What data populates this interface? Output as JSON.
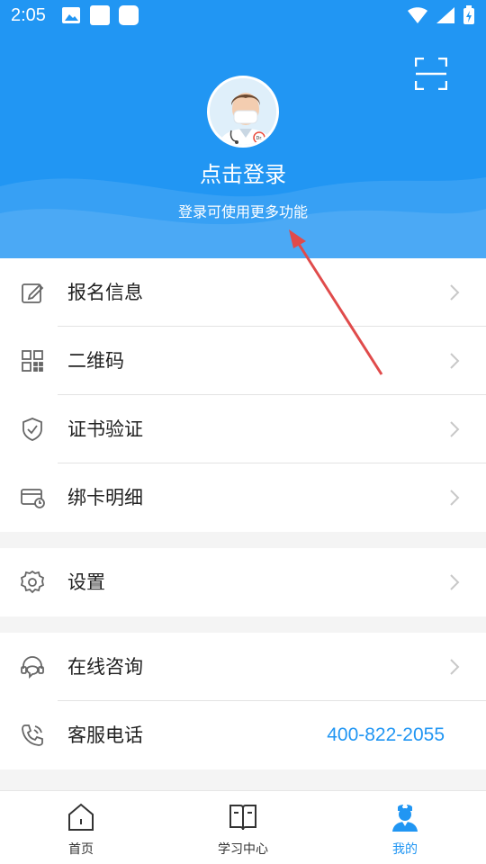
{
  "status_bar": {
    "time": "2:05"
  },
  "header": {
    "login_title": "点击登录",
    "login_subtitle": "登录可使用更多功能",
    "scan_icon": "scan-icon",
    "avatar_badge": "Dr."
  },
  "menu_group_1": [
    {
      "label": "报名信息",
      "icon": "edit-icon"
    },
    {
      "label": "二维码",
      "icon": "qrcode-icon"
    },
    {
      "label": "证书验证",
      "icon": "shield-check-icon"
    },
    {
      "label": "绑卡明细",
      "icon": "card-icon"
    }
  ],
  "menu_group_2": [
    {
      "label": "设置",
      "icon": "gear-icon"
    }
  ],
  "menu_group_3": [
    {
      "label": "在线咨询",
      "icon": "headset-icon"
    },
    {
      "label": "客服电话",
      "icon": "phone-icon",
      "value": "400-822-2055"
    }
  ],
  "tabs": [
    {
      "label": "首页",
      "icon": "home-icon"
    },
    {
      "label": "学习中心",
      "icon": "book-icon"
    },
    {
      "label": "我的",
      "icon": "doctor-icon",
      "active": true
    }
  ],
  "colors": {
    "accent": "#2196f3",
    "arrow": "#e04b4b"
  }
}
